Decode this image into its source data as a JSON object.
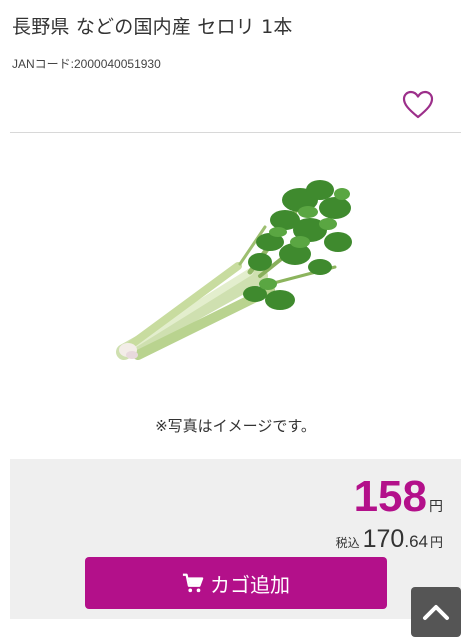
{
  "product": {
    "title": "長野県 などの国内産 セロリ 1本",
    "jan": "JANコード:2000040051930",
    "image_note": "※写真はイメージです。"
  },
  "favorite": {
    "icon": "heart-outline-icon",
    "color": "#9c2f8a"
  },
  "price": {
    "value": "158",
    "unit": "円",
    "tax_label": "税込",
    "tax_value_int": "170",
    "tax_value_dec": ".64",
    "tax_unit": "円"
  },
  "cart": {
    "label": "カゴ追加",
    "icon": "cart-icon"
  },
  "scroll_top": {
    "icon": "chevron-up-icon"
  },
  "colors": {
    "accent": "#b3108a",
    "panel": "#efefef",
    "scroll_button": "#555555"
  }
}
